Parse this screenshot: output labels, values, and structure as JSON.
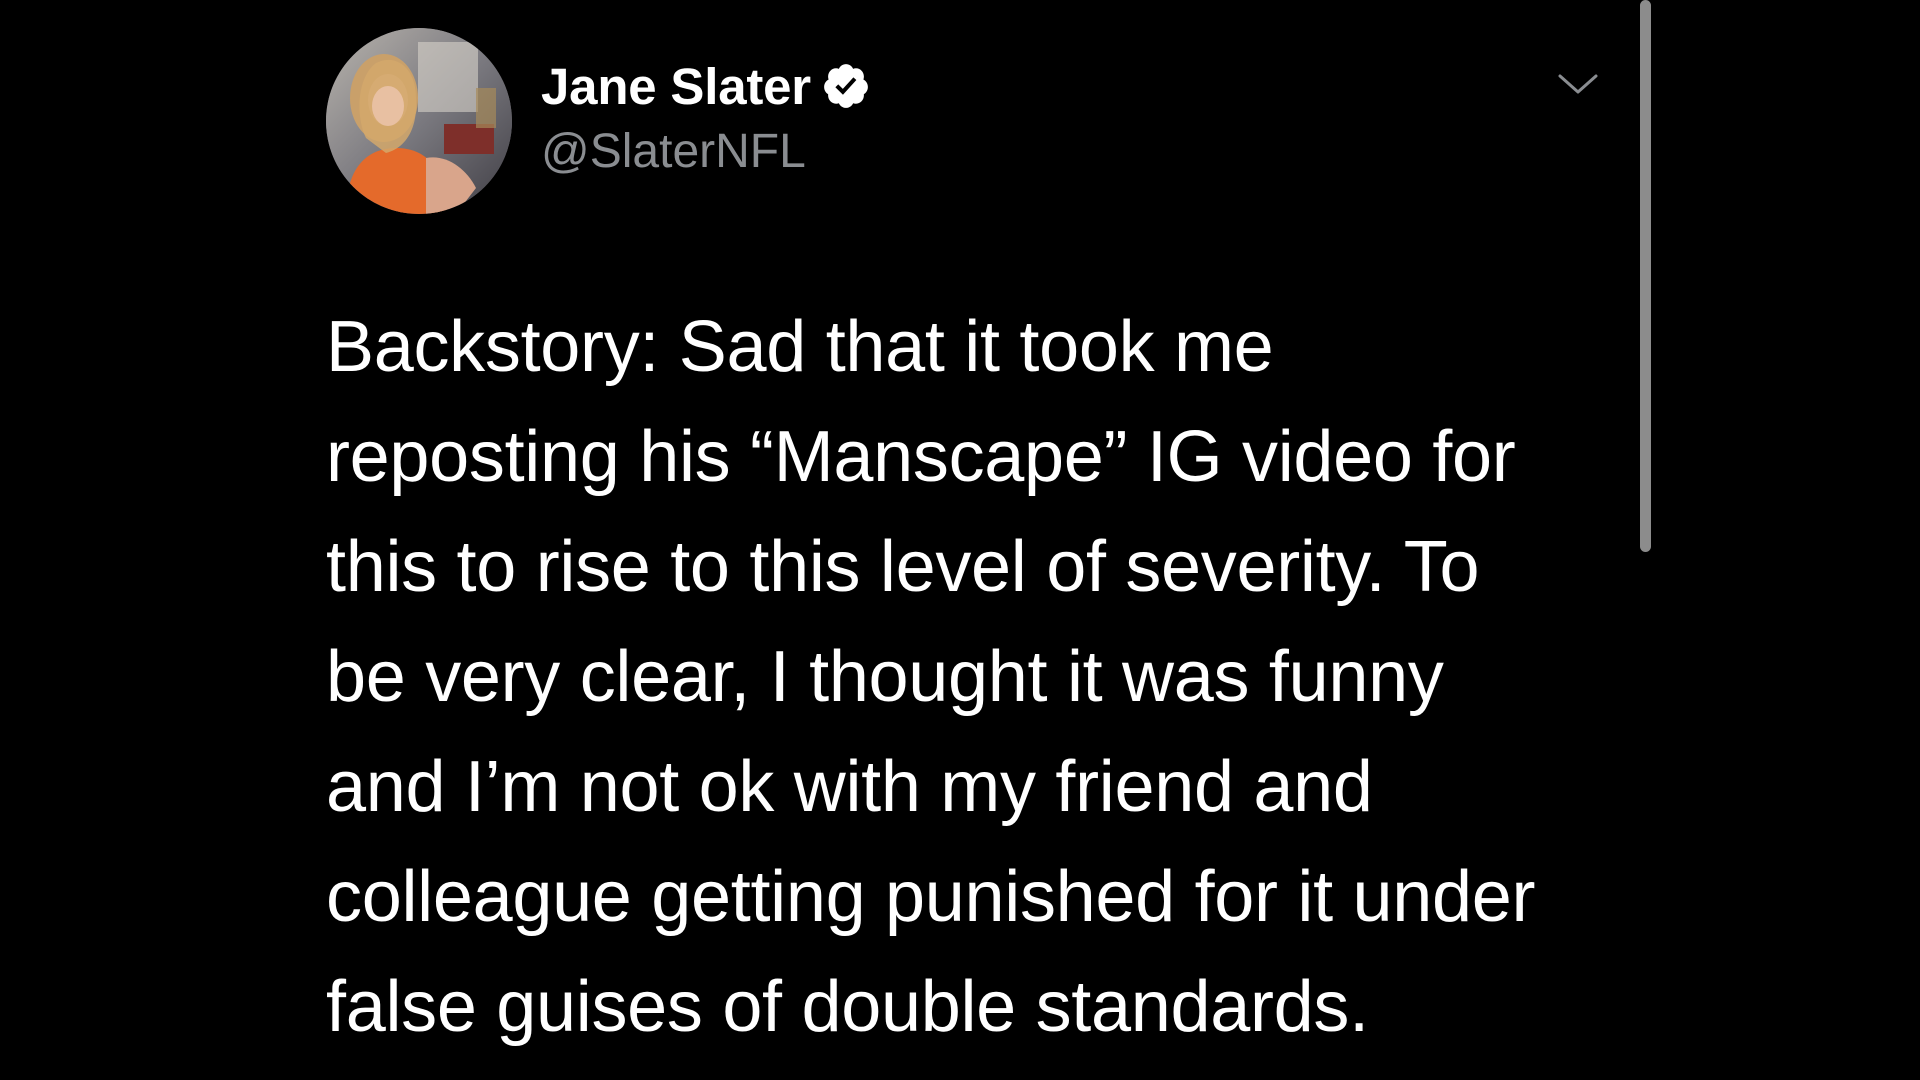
{
  "tweet": {
    "author": {
      "display_name": "Jane Slater",
      "handle": "@SlaterNFL",
      "verified": true,
      "verified_icon": "verified-badge-icon"
    },
    "menu_icon": "chevron-down-icon",
    "body_lines": [
      "Backstory: Sad that it took me",
      "reposting his “Manscape” IG video for",
      "this to rise to this level of severity. To",
      "be very clear, I thought it was funny",
      "and I’m not ok with my friend and",
      "colleague getting punished for it under",
      "false guises of double standards."
    ]
  },
  "colors": {
    "background": "#000000",
    "text_primary": "#ffffff",
    "text_secondary": "#8a8d91",
    "scrollbar": "#8c8c8c"
  }
}
